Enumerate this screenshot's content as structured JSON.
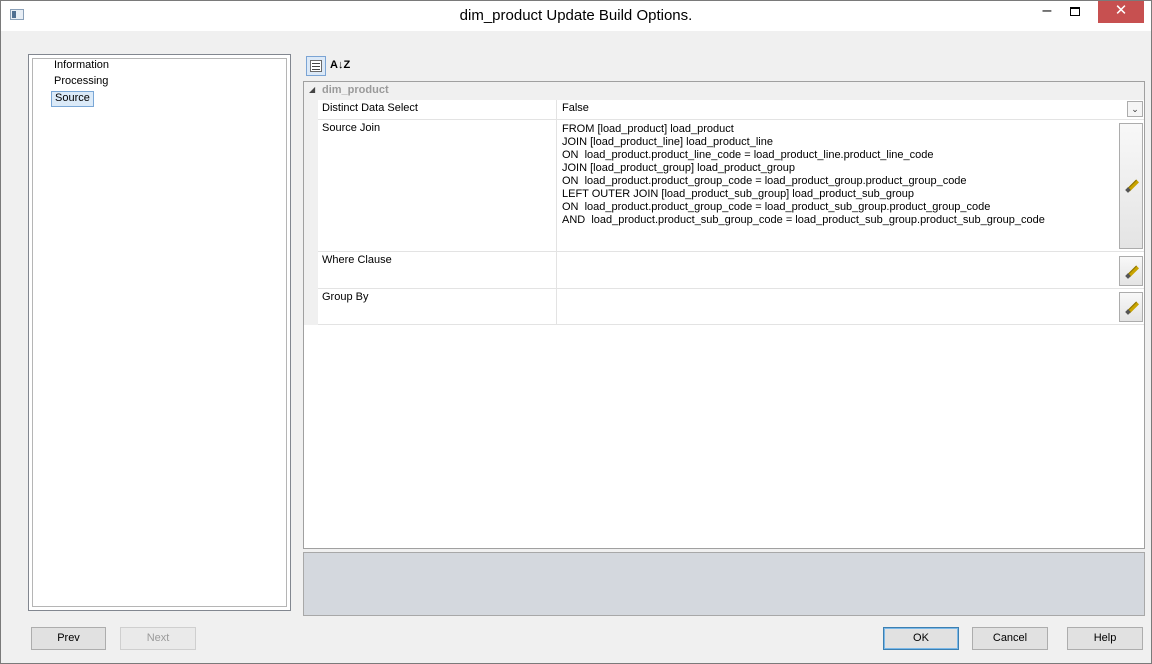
{
  "window": {
    "title": "dim_product Update Build Options.",
    "controls": {
      "minimize": "–",
      "close": "✕"
    }
  },
  "nav": {
    "items": [
      {
        "label": "Information",
        "selected": false
      },
      {
        "label": "Processing",
        "selected": false
      },
      {
        "label": "Source",
        "selected": true
      }
    ]
  },
  "toolbar": {
    "categorized_icon": "categorized-view-icon",
    "alphabetical_label": "A↓Z"
  },
  "grid": {
    "category": {
      "arrow": "◢",
      "label": "dim_product"
    },
    "properties": [
      {
        "name": "Distinct Data Select",
        "value": "False",
        "editor": "dropdown",
        "dropdown_glyph": "⌄"
      },
      {
        "name": "Source Join",
        "value": "FROM [load_product] load_product\nJOIN [load_product_line] load_product_line\nON  load_product.product_line_code = load_product_line.product_line_code\nJOIN [load_product_group] load_product_group\nON  load_product.product_group_code = load_product_group.product_group_code\nLEFT OUTER JOIN [load_product_sub_group] load_product_sub_group\nON  load_product.product_group_code = load_product_sub_group.product_group_code\nAND  load_product.product_sub_group_code = load_product_sub_group.product_sub_group_code",
        "editor": "pencil-edit-icon"
      },
      {
        "name": "Where Clause",
        "value": "",
        "editor": "pencil-edit-icon"
      },
      {
        "name": "Group By",
        "value": "",
        "editor": "pencil-edit-icon"
      }
    ]
  },
  "buttons": {
    "prev": "Prev",
    "next": "Next",
    "ok": "OK",
    "cancel": "Cancel",
    "help": "Help"
  }
}
